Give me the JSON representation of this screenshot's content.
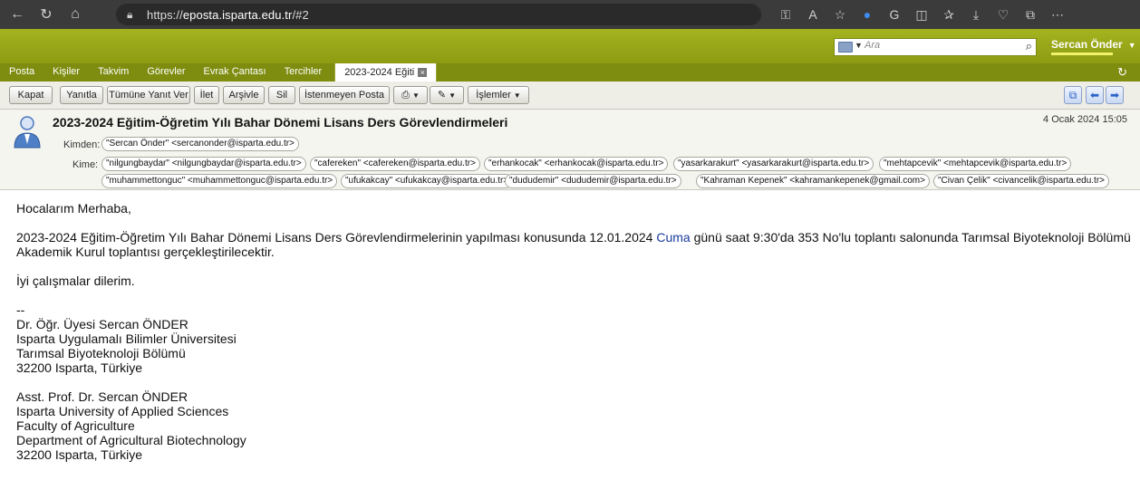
{
  "browser": {
    "url_prefix": "https://",
    "url_host": "eposta.isparta.edu.tr",
    "url_path": "/#2"
  },
  "header": {
    "search_placeholder": "Ara",
    "user_name": "Sercan Önder"
  },
  "tabs": [
    {
      "label": "Posta"
    },
    {
      "label": "Kişiler"
    },
    {
      "label": "Takvim"
    },
    {
      "label": "Görevler"
    },
    {
      "label": "Evrak Çantası"
    },
    {
      "label": "Tercihler"
    },
    {
      "label": "2023-2024 Eğiti"
    }
  ],
  "toolbar": {
    "close": "Kapat",
    "reply": "Yanıtla",
    "reply_all": "Tümüne Yanıt Ver",
    "forward": "İlet",
    "archive": "Arşivle",
    "delete": "Sil",
    "spam": "İstenmeyen Posta",
    "actions": "İşlemler"
  },
  "message": {
    "subject": "2023-2024 Eğitim-Öğretim Yılı Bahar Dönemi Lisans Ders Görevlendirmeleri",
    "date": "4 Ocak 2024 15:05",
    "from_label": "Kimden:",
    "from": "\"Sercan Önder\" <sercanonder@isparta.edu.tr>",
    "to_label": "Kime:",
    "to": [
      "\"nilgungbaydar\" <nilgungbaydar@isparta.edu.tr>",
      "\"cafereken\" <cafereken@isparta.edu.tr>",
      "\"erhankocak\" <erhankocak@isparta.edu.tr>",
      "\"yasarkarakurt\" <yasarkarakurt@isparta.edu.tr>",
      "\"mehtapcevik\" <mehtapcevik@isparta.edu.tr>",
      "\"muhammettonguc\" <muhammettonguc@isparta.edu.tr>",
      "\"ufukakcay\" <ufukakcay@isparta.edu.tr>",
      "\"dududemir\" <dududemir@isparta.edu.tr>",
      "\"Kahraman Kepenek\" <kahramankepenek@gmail.com>",
      "\"Civan Çelik\" <civancelik@isparta.edu.tr>"
    ],
    "body": {
      "greeting": "Hocalarım Merhaba,",
      "para1_before": "2023-2024 Eğitim-Öğretim Yılı Bahar Dönemi Lisans Ders Görevlendirmelerinin yapılması konusunda 12.01.2024 ",
      "para1_link": "Cuma",
      "para1_after": " günü saat 9:30'da 353 No'lu toplantı salonunda Tarımsal Biyoteknoloji Bölümü",
      "para1_line2": "Akademik Kurul toplantısı gerçekleştirilecektir.",
      "closing": "İyi çalışmalar dilerim.",
      "sig_sep": "--",
      "sig_tr": [
        "Dr. Öğr. Üyesi Sercan ÖNDER",
        "Isparta Uygulamalı Bilimler Üniversitesi",
        "Tarımsal Biyoteknoloji Bölümü",
        "32200 Isparta, Türkiye"
      ],
      "sig_en": [
        "Asst. Prof. Dr. Sercan ÖNDER",
        "Isparta University of Applied Sciences",
        "Faculty of Agriculture",
        "Department of Agricultural Biotechnology",
        "32200 Isparta, Türkiye"
      ]
    }
  }
}
